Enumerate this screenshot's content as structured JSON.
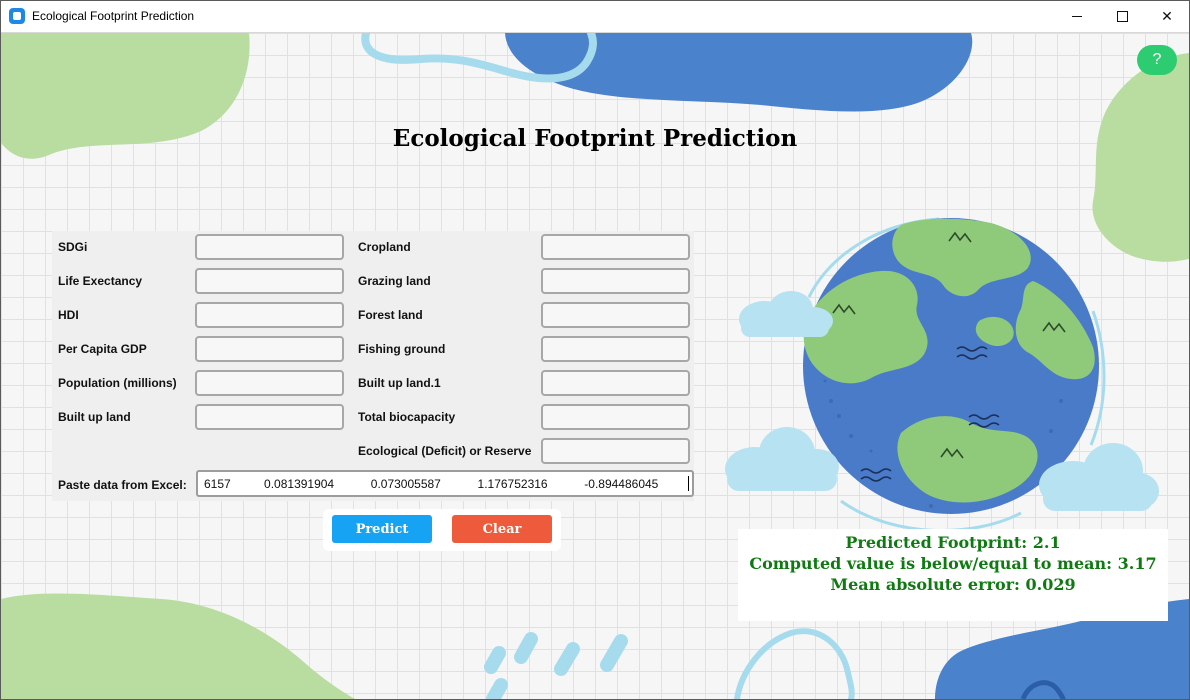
{
  "window": {
    "title": "Ecological Footprint Prediction",
    "controls": {
      "minimize": "minimize",
      "maximize": "maximize",
      "close": "✕"
    }
  },
  "help_label": "?",
  "heading": "Ecological Footprint Prediction",
  "form": {
    "left_labels": [
      "SDGi",
      "Life Exectancy",
      "HDI",
      "Per Capita GDP",
      "Population (millions)",
      "Built up land"
    ],
    "right_labels": [
      "Cropland",
      "Grazing land",
      "Forest land",
      "Fishing ground",
      "Built up land.1",
      "Total biocapacity",
      "Ecological (Deficit) or Reserve"
    ],
    "paste_label": "Paste data from Excel:",
    "paste_value": "6157          0.081391904           0.073005587           1.176752316           -0.894486045"
  },
  "buttons": {
    "predict": "Predict",
    "clear": "Clear"
  },
  "results": {
    "predicted": "Predicted Footprint: 2.1",
    "comparison": "Computed value is below/equal to mean: 3.17",
    "mae": "Mean absolute error: 0.029"
  },
  "colors": {
    "green_blob": "#b9dca0",
    "blue_blob": "#4b82cc",
    "light_blue": "#a6dbee",
    "help": "#2ecc71",
    "predict": "#17a3f4",
    "clear": "#ee5b3c",
    "result_text": "#0f7a11"
  }
}
